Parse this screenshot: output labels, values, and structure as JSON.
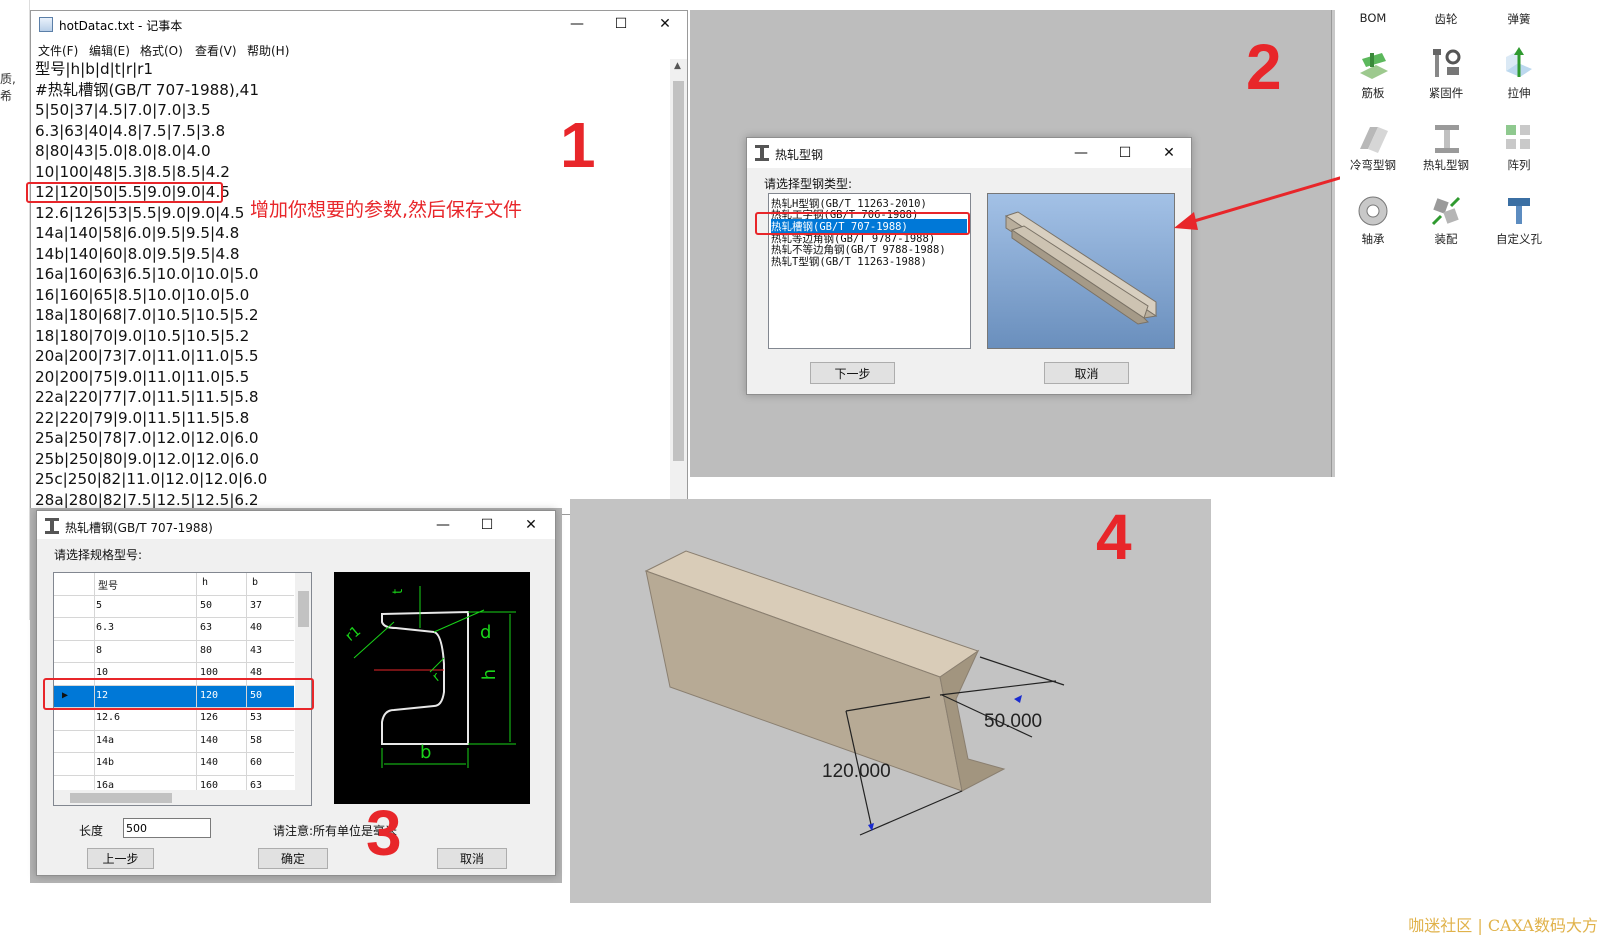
{
  "notepad": {
    "title": "hotDatac.txt - 记事本",
    "menus": [
      "文件(F)",
      "编辑(E)",
      "格式(O)",
      "查看(V)",
      "帮助(H)"
    ],
    "lines": [
      "型号|h|b|d|t|r|r1",
      "#热轧槽钢(GB/T 707-1988),41",
      "5|50|37|4.5|7.0|7.0|3.5",
      "6.3|63|40|4.8|7.5|7.5|3.8",
      "8|80|43|5.0|8.0|8.0|4.0",
      "10|100|48|5.3|8.5|8.5|4.2",
      "12|120|50|5.5|9.0|9.0|4.5",
      "12.6|126|53|5.5|9.0|9.0|4.5",
      "14a|140|58|6.0|9.5|9.5|4.8",
      "14b|140|60|8.0|9.5|9.5|4.8",
      "16a|160|63|6.5|10.0|10.0|5.0",
      "16|160|65|8.5|10.0|10.0|5.0",
      "18a|180|68|7.0|10.5|10.5|5.2",
      "18|180|70|9.0|10.5|10.5|5.2",
      "20a|200|73|7.0|11.0|11.0|5.5",
      "20|200|75|9.0|11.0|11.0|5.5",
      "22a|220|77|7.0|11.5|11.5|5.8",
      "22|220|79|9.0|11.5|11.5|5.8",
      "25a|250|78|7.0|12.0|12.0|6.0",
      "25b|250|80|9.0|12.0|12.0|6.0",
      "25c|250|82|11.0|12.0|12.0|6.0",
      "28a|280|82|7.5|12.5|12.5|6.2"
    ],
    "annotation": "增加你想要的参数,然后保存文件"
  },
  "left_fragment": "质, 希",
  "step_numbers": {
    "one": "1",
    "two": "2",
    "three": "3",
    "four": "4"
  },
  "dialog_type": {
    "title": "热轧型钢",
    "prompt": "请选择型钢类型:",
    "items": [
      "热轧H型钢(GB/T 11263-2010)",
      "热轧工字钢(GB/T 706-1988)",
      "热轧槽钢(GB/T 707-1988)",
      "热轧等边角钢(GB/T 9787-1988)",
      "热轧不等边角钢(GB/T 9788-1988)",
      "热轧T型钢(GB/T 11263-1988)"
    ],
    "selected_index": 2,
    "next_button": "下一步",
    "cancel_button": "取消"
  },
  "toolbar": {
    "items": [
      {
        "label": "BOM",
        "icon": "bom-icon"
      },
      {
        "label": "齿轮",
        "icon": "gear-icon"
      },
      {
        "label": "弹簧",
        "icon": "spring-icon"
      },
      {
        "label": "筋板",
        "icon": "rib-icon"
      },
      {
        "label": "紧固件",
        "icon": "fastener-icon"
      },
      {
        "label": "拉伸",
        "icon": "extrude-icon"
      },
      {
        "label": "冷弯型钢",
        "icon": "cold-formed-steel-icon"
      },
      {
        "label": "热轧型钢",
        "icon": "hot-rolled-steel-icon"
      },
      {
        "label": "阵列",
        "icon": "array-icon"
      },
      {
        "label": "轴承",
        "icon": "bearing-icon"
      },
      {
        "label": "装配",
        "icon": "assembly-icon"
      },
      {
        "label": "自定义孔",
        "icon": "custom-hole-icon"
      }
    ]
  },
  "dialog_spec": {
    "title": "热轧槽钢(GB/T 707-1988)",
    "prompt": "请选择规格型号:",
    "columns": [
      "型号",
      "h",
      "b"
    ],
    "rows": [
      [
        "5",
        "50",
        "37"
      ],
      [
        "6.3",
        "63",
        "40"
      ],
      [
        "8",
        "80",
        "43"
      ],
      [
        "10",
        "100",
        "48"
      ],
      [
        "12",
        "120",
        "50"
      ],
      [
        "12.6",
        "126",
        "53"
      ],
      [
        "14a",
        "140",
        "58"
      ],
      [
        "14b",
        "140",
        "60"
      ],
      [
        "16a",
        "160",
        "63"
      ]
    ],
    "selected_index": 4,
    "length_label": "长度",
    "length_value": "500",
    "note": "请注意:所有单位是毫米",
    "prev_button": "上一步",
    "ok_button": "确定",
    "cancel_button": "取消",
    "diagram_labels": {
      "t": "t",
      "r1": "r1",
      "d": "d",
      "r": "r",
      "h": "h",
      "b": "b"
    }
  },
  "model_view": {
    "dim_width": "50.000",
    "dim_height": "120.000"
  },
  "watermark": "咖迷社区 | CAXA数码大方",
  "colors": {
    "accent_red": "#e8262a",
    "selection_blue": "#0078d7",
    "cad_green": "#19d319"
  }
}
